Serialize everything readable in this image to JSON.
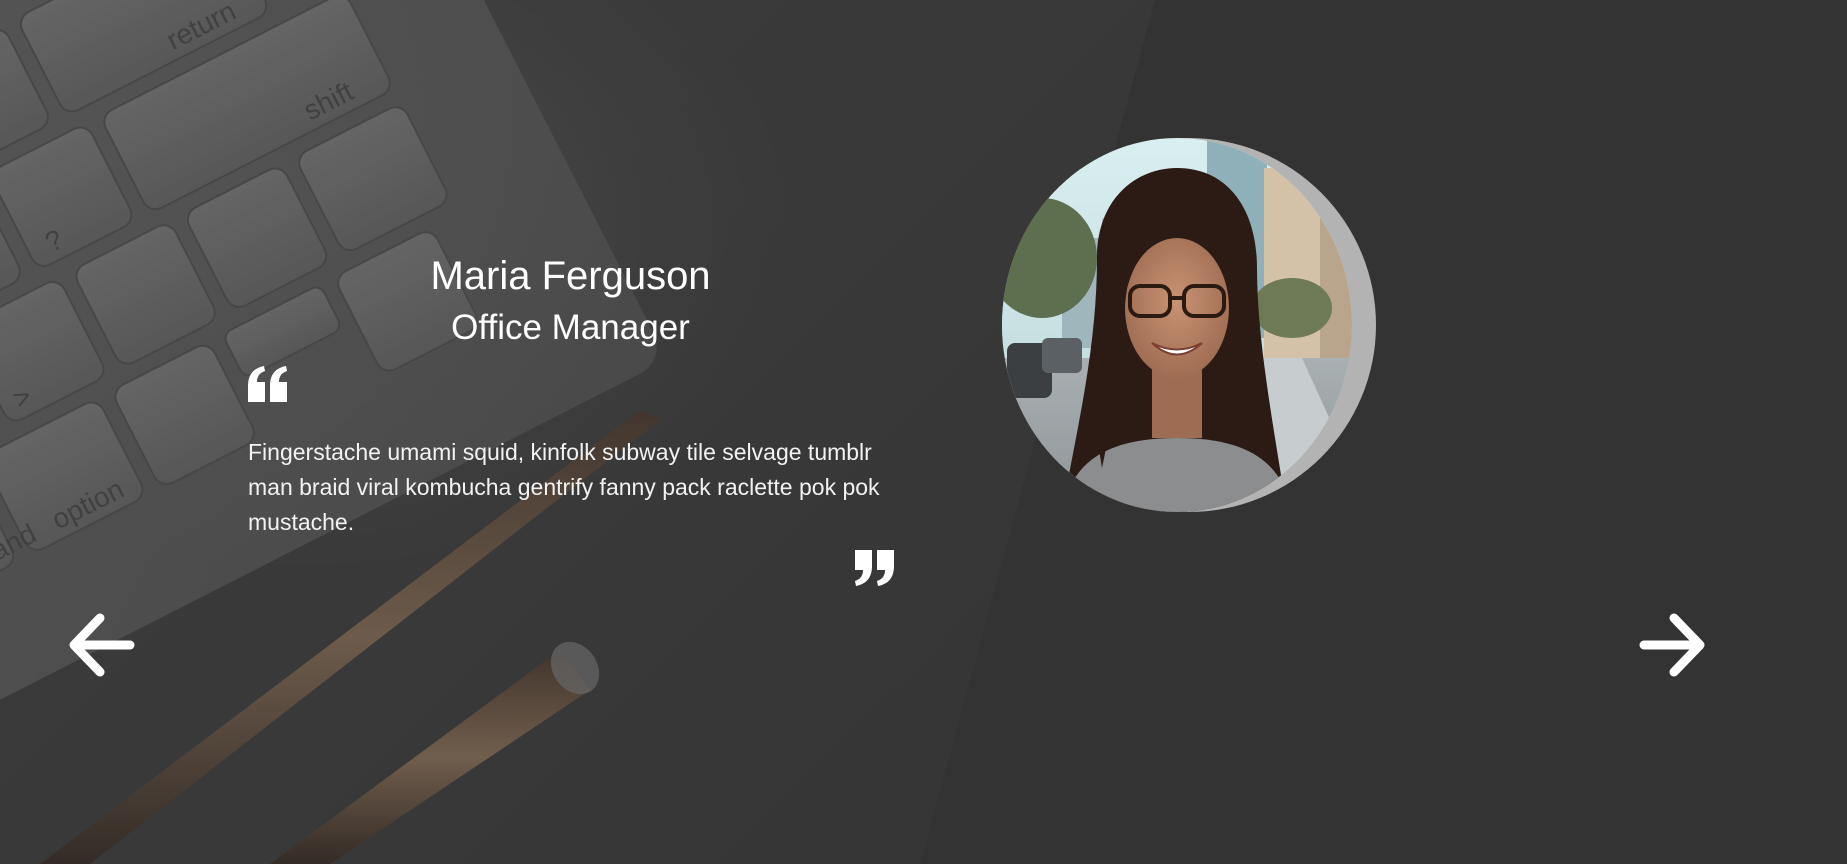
{
  "testimonial": {
    "name": "Maria Ferguson",
    "role": "Office Manager",
    "quote": "Fingerstache umami squid, kinfolk subway tile selvage tumblr man braid viral kombucha gentrify fanny pack raclette pok pok mustache."
  },
  "keyboard": {
    "keys": [
      "return",
      "shift",
      "option",
      "command"
    ]
  },
  "icons": {
    "quote_open": "quote-open-icon",
    "quote_close": "quote-close-icon",
    "prev": "arrow-left-icon",
    "next": "arrow-right-icon"
  },
  "colors": {
    "background": "#333333",
    "text": "#ffffff",
    "avatar_shadow": "#b3b3b3"
  }
}
